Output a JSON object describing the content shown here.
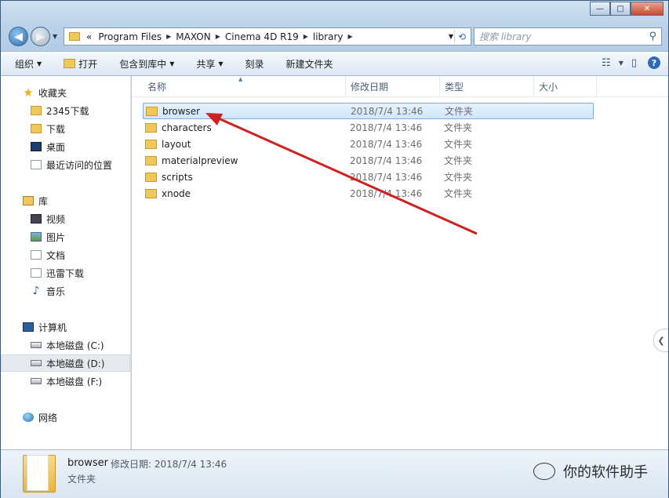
{
  "window": {
    "controls": {
      "minimize": "—",
      "maximize": "□",
      "close": "✕"
    }
  },
  "nav": {
    "back_icon": "back-arrow-icon",
    "forward_icon": "forward-arrow-icon",
    "address": {
      "overflow": "«",
      "segments": [
        "Program Files",
        "MAXON",
        "Cinema 4D R19",
        "library"
      ]
    },
    "search_placeholder": "搜索 library"
  },
  "toolbar": {
    "organize": "组织",
    "open": "打开",
    "include_in_library": "包含到库中",
    "share": "共享",
    "burn": "刻录",
    "new_folder": "新建文件夹"
  },
  "sidebar": {
    "favorites": {
      "title": "收藏夹",
      "items": [
        "2345下载",
        "下载",
        "桌面",
        "最近访问的位置"
      ]
    },
    "libraries": {
      "title": "库",
      "items": [
        "视频",
        "图片",
        "文档",
        "迅雷下载",
        "音乐"
      ]
    },
    "computer": {
      "title": "计算机",
      "items": [
        "本地磁盘 (C:)",
        "本地磁盘 (D:)",
        "本地磁盘 (F:)"
      ],
      "selected": "本地磁盘 (D:)"
    },
    "network": {
      "title": "网络"
    }
  },
  "columns": {
    "name": "名称",
    "modified": "修改日期",
    "type": "类型",
    "size": "大小"
  },
  "files": [
    {
      "name": "browser",
      "modified": "2018/7/4 13:46",
      "type": "文件夹",
      "selected": true
    },
    {
      "name": "characters",
      "modified": "2018/7/4 13:46",
      "type": "文件夹"
    },
    {
      "name": "layout",
      "modified": "2018/7/4 13:46",
      "type": "文件夹"
    },
    {
      "name": "materialpreview",
      "modified": "2018/7/4 13:46",
      "type": "文件夹"
    },
    {
      "name": "scripts",
      "modified": "2018/7/4 13:46",
      "type": "文件夹"
    },
    {
      "name": "xnode",
      "modified": "2018/7/4 13:46",
      "type": "文件夹"
    }
  ],
  "details": {
    "name": "browser",
    "modified_label": "修改日期: 2018/7/4 13:46",
    "type": "文件夹"
  },
  "watermark": "你的软件助手",
  "annotation": {
    "arrow_color": "#d02020"
  },
  "colors": {
    "selection": "#cfe6fb",
    "chrome": "#bcd3ea"
  }
}
